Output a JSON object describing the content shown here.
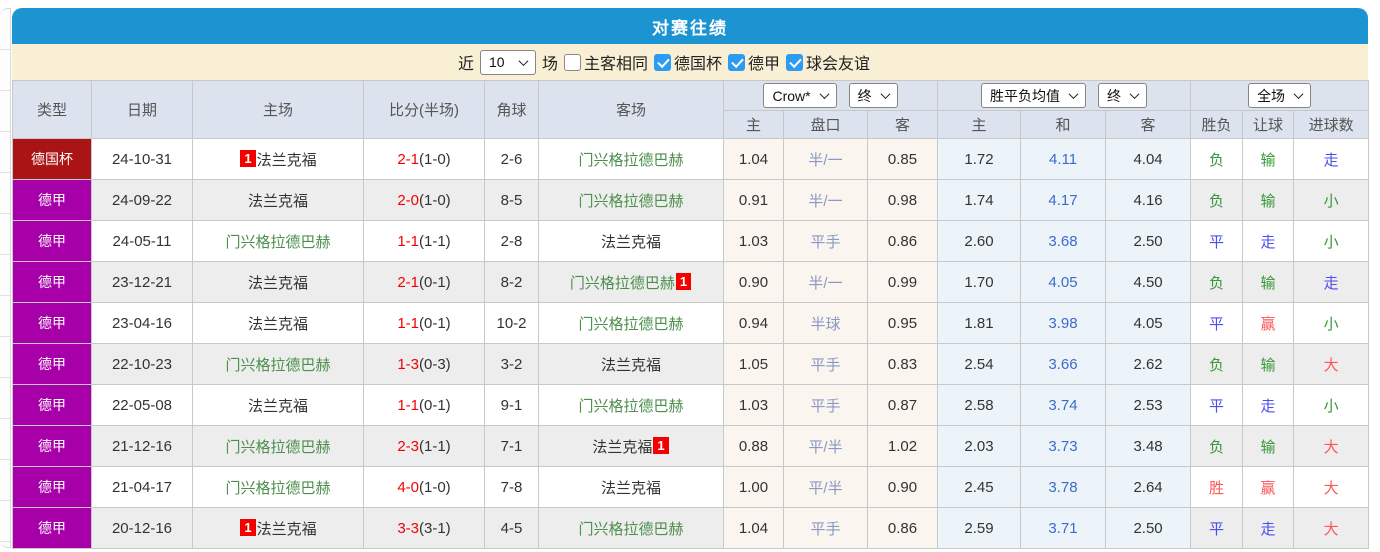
{
  "page": {
    "title": "对赛往绩"
  },
  "filter": {
    "recent_label": "近",
    "count_value": "10",
    "games_label": "场",
    "same_venue_label": "主客相同",
    "same_venue_checked": false,
    "competitions": [
      {
        "label": "德国杯",
        "checked": true
      },
      {
        "label": "德甲",
        "checked": true
      },
      {
        "label": "球会友谊",
        "checked": true
      }
    ]
  },
  "table": {
    "headers": [
      "类型",
      "日期",
      "主场",
      "比分(半场)",
      "角球",
      "客场"
    ],
    "selects": {
      "company": "Crow*",
      "company_time": "终",
      "avg": "胜平负均值",
      "avg_time": "终",
      "scope": "全场"
    },
    "sub_headers": [
      "主",
      "盘口",
      "客",
      "主",
      "和",
      "客",
      "胜负",
      "让球",
      "进球数"
    ],
    "colors": {
      "accent_blue": "#1d94d2",
      "filter_cream": "#f9efd5",
      "header_gray_blue": "#dce3ee",
      "cup_red": "#aa1414",
      "league_purple": "#a800a8",
      "score_red": "#f50000",
      "team_green": "#4d8f4d",
      "handicap_line_blue": "#8b97c6",
      "avg_draw_blue": "#3d6acb",
      "result_red": "#ff5555",
      "result_blue": "#4d4df2",
      "result_green": "#389738"
    },
    "rows": [
      {
        "type": "德国杯",
        "type_class": "cup",
        "date": "24-10-31",
        "home": {
          "name": "法兰克福",
          "cls": "dark",
          "badge": "before",
          "badge_text": "1"
        },
        "score_ft": "2-1",
        "score_ht": "(1-0)",
        "corners": "2-6",
        "away": {
          "name": "门兴格拉德巴赫",
          "cls": "green",
          "badge": null,
          "badge_text": ""
        },
        "crow_home": "1.04",
        "crow_line": "半/一",
        "crow_away": "0.85",
        "avg_home": "1.72",
        "avg_draw": "4.11",
        "avg_away": "4.04",
        "res_wdl": {
          "t": "负",
          "c": "green"
        },
        "res_hcp": {
          "t": "输",
          "c": "green"
        },
        "res_goal": {
          "t": "走",
          "c": "blue"
        }
      },
      {
        "type": "德甲",
        "type_class": "league",
        "date": "24-09-22",
        "home": {
          "name": "法兰克福",
          "cls": "dark",
          "badge": null,
          "badge_text": ""
        },
        "score_ft": "2-0",
        "score_ht": "(1-0)",
        "corners": "8-5",
        "away": {
          "name": "门兴格拉德巴赫",
          "cls": "green",
          "badge": null,
          "badge_text": ""
        },
        "crow_home": "0.91",
        "crow_line": "半/一",
        "crow_away": "0.98",
        "avg_home": "1.74",
        "avg_draw": "4.17",
        "avg_away": "4.16",
        "res_wdl": {
          "t": "负",
          "c": "green"
        },
        "res_hcp": {
          "t": "输",
          "c": "green"
        },
        "res_goal": {
          "t": "小",
          "c": "green"
        }
      },
      {
        "type": "德甲",
        "type_class": "league",
        "date": "24-05-11",
        "home": {
          "name": "门兴格拉德巴赫",
          "cls": "green",
          "badge": null,
          "badge_text": ""
        },
        "score_ft": "1-1",
        "score_ht": "(1-1)",
        "corners": "2-8",
        "away": {
          "name": "法兰克福",
          "cls": "dark",
          "badge": null,
          "badge_text": ""
        },
        "crow_home": "1.03",
        "crow_line": "平手",
        "crow_away": "0.86",
        "avg_home": "2.60",
        "avg_draw": "3.68",
        "avg_away": "2.50",
        "res_wdl": {
          "t": "平",
          "c": "blue"
        },
        "res_hcp": {
          "t": "走",
          "c": "blue"
        },
        "res_goal": {
          "t": "小",
          "c": "green"
        }
      },
      {
        "type": "德甲",
        "type_class": "league",
        "date": "23-12-21",
        "home": {
          "name": "法兰克福",
          "cls": "dark",
          "badge": null,
          "badge_text": ""
        },
        "score_ft": "2-1",
        "score_ht": "(0-1)",
        "corners": "8-2",
        "away": {
          "name": "门兴格拉德巴赫",
          "cls": "green",
          "badge": "after",
          "badge_text": "1"
        },
        "crow_home": "0.90",
        "crow_line": "半/一",
        "crow_away": "0.99",
        "avg_home": "1.70",
        "avg_draw": "4.05",
        "avg_away": "4.50",
        "res_wdl": {
          "t": "负",
          "c": "green"
        },
        "res_hcp": {
          "t": "输",
          "c": "green"
        },
        "res_goal": {
          "t": "走",
          "c": "blue"
        }
      },
      {
        "type": "德甲",
        "type_class": "league",
        "date": "23-04-16",
        "home": {
          "name": "法兰克福",
          "cls": "dark",
          "badge": null,
          "badge_text": ""
        },
        "score_ft": "1-1",
        "score_ht": "(0-1)",
        "corners": "10-2",
        "away": {
          "name": "门兴格拉德巴赫",
          "cls": "green",
          "badge": null,
          "badge_text": ""
        },
        "crow_home": "0.94",
        "crow_line": "半球",
        "crow_away": "0.95",
        "avg_home": "1.81",
        "avg_draw": "3.98",
        "avg_away": "4.05",
        "res_wdl": {
          "t": "平",
          "c": "blue"
        },
        "res_hcp": {
          "t": "赢",
          "c": "red"
        },
        "res_goal": {
          "t": "小",
          "c": "green"
        }
      },
      {
        "type": "德甲",
        "type_class": "league",
        "date": "22-10-23",
        "home": {
          "name": "门兴格拉德巴赫",
          "cls": "green",
          "badge": null,
          "badge_text": ""
        },
        "score_ft": "1-3",
        "score_ht": "(0-3)",
        "corners": "3-2",
        "away": {
          "name": "法兰克福",
          "cls": "dark",
          "badge": null,
          "badge_text": ""
        },
        "crow_home": "1.05",
        "crow_line": "平手",
        "crow_away": "0.83",
        "avg_home": "2.54",
        "avg_draw": "3.66",
        "avg_away": "2.62",
        "res_wdl": {
          "t": "负",
          "c": "green"
        },
        "res_hcp": {
          "t": "输",
          "c": "green"
        },
        "res_goal": {
          "t": "大",
          "c": "red"
        }
      },
      {
        "type": "德甲",
        "type_class": "league",
        "date": "22-05-08",
        "home": {
          "name": "法兰克福",
          "cls": "dark",
          "badge": null,
          "badge_text": ""
        },
        "score_ft": "1-1",
        "score_ht": "(0-1)",
        "corners": "9-1",
        "away": {
          "name": "门兴格拉德巴赫",
          "cls": "green",
          "badge": null,
          "badge_text": ""
        },
        "crow_home": "1.03",
        "crow_line": "平手",
        "crow_away": "0.87",
        "avg_home": "2.58",
        "avg_draw": "3.74",
        "avg_away": "2.53",
        "res_wdl": {
          "t": "平",
          "c": "blue"
        },
        "res_hcp": {
          "t": "走",
          "c": "blue"
        },
        "res_goal": {
          "t": "小",
          "c": "green"
        }
      },
      {
        "type": "德甲",
        "type_class": "league",
        "date": "21-12-16",
        "home": {
          "name": "门兴格拉德巴赫",
          "cls": "green",
          "badge": null,
          "badge_text": ""
        },
        "score_ft": "2-3",
        "score_ht": "(1-1)",
        "corners": "7-1",
        "away": {
          "name": "法兰克福",
          "cls": "dark",
          "badge": "after",
          "badge_text": "1"
        },
        "crow_home": "0.88",
        "crow_line": "平/半",
        "crow_away": "1.02",
        "avg_home": "2.03",
        "avg_draw": "3.73",
        "avg_away": "3.48",
        "res_wdl": {
          "t": "负",
          "c": "green"
        },
        "res_hcp": {
          "t": "输",
          "c": "green"
        },
        "res_goal": {
          "t": "大",
          "c": "red"
        }
      },
      {
        "type": "德甲",
        "type_class": "league",
        "date": "21-04-17",
        "home": {
          "name": "门兴格拉德巴赫",
          "cls": "green",
          "badge": null,
          "badge_text": ""
        },
        "score_ft": "4-0",
        "score_ht": "(1-0)",
        "corners": "7-8",
        "away": {
          "name": "法兰克福",
          "cls": "dark",
          "badge": null,
          "badge_text": ""
        },
        "crow_home": "1.00",
        "crow_line": "平/半",
        "crow_away": "0.90",
        "avg_home": "2.45",
        "avg_draw": "3.78",
        "avg_away": "2.64",
        "res_wdl": {
          "t": "胜",
          "c": "red"
        },
        "res_hcp": {
          "t": "赢",
          "c": "red"
        },
        "res_goal": {
          "t": "大",
          "c": "red"
        }
      },
      {
        "type": "德甲",
        "type_class": "league",
        "date": "20-12-16",
        "home": {
          "name": "法兰克福",
          "cls": "dark",
          "badge": "before",
          "badge_text": "1"
        },
        "score_ft": "3-3",
        "score_ht": "(3-1)",
        "corners": "4-5",
        "away": {
          "name": "门兴格拉德巴赫",
          "cls": "green",
          "badge": null,
          "badge_text": ""
        },
        "crow_home": "1.04",
        "crow_line": "平手",
        "crow_away": "0.86",
        "avg_home": "2.59",
        "avg_draw": "3.71",
        "avg_away": "2.50",
        "res_wdl": {
          "t": "平",
          "c": "blue"
        },
        "res_hcp": {
          "t": "走",
          "c": "blue"
        },
        "res_goal": {
          "t": "大",
          "c": "red"
        }
      }
    ]
  }
}
